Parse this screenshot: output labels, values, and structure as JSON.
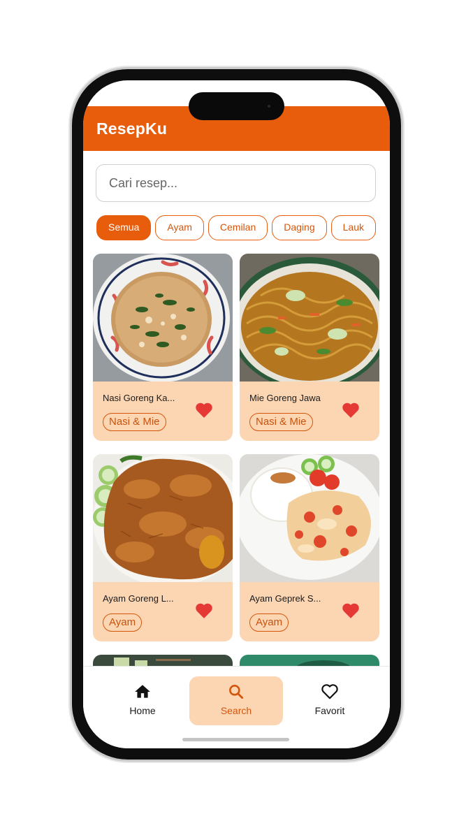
{
  "app": {
    "title": "ResepKu"
  },
  "search": {
    "placeholder": "Cari resep..."
  },
  "categories": [
    {
      "label": "Semua",
      "active": true
    },
    {
      "label": "Ayam",
      "active": false
    },
    {
      "label": "Cemilan",
      "active": false
    },
    {
      "label": "Daging",
      "active": false
    },
    {
      "label": "Lauk",
      "active": false
    }
  ],
  "recipes": [
    {
      "name": "Nasi Goreng Ka...",
      "category": "Nasi & Mie",
      "favorite": true,
      "image": "fried-rice"
    },
    {
      "name": "Mie Goreng Jawa",
      "category": "Nasi & Mie",
      "favorite": true,
      "image": "fried-noodles"
    },
    {
      "name": "Ayam Goreng L...",
      "category": "Ayam",
      "favorite": true,
      "image": "fried-chicken"
    },
    {
      "name": "Ayam Geprek S...",
      "category": "Ayam",
      "favorite": true,
      "image": "smashed-chicken"
    }
  ],
  "bottom_nav": [
    {
      "label": "Home",
      "icon": "home-icon",
      "active": false
    },
    {
      "label": "Search",
      "icon": "search-icon",
      "active": true
    },
    {
      "label": "Favorit",
      "icon": "heart-outline-icon",
      "active": false
    }
  ],
  "colors": {
    "primary": "#e85d0c",
    "card_bg": "#fcd6b3",
    "heart": "#e53935"
  }
}
